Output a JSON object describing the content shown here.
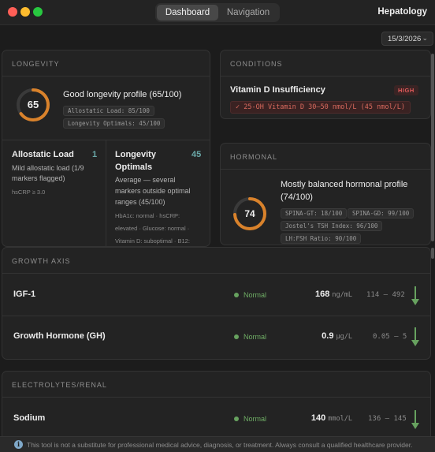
{
  "window": {
    "tabs": [
      {
        "label": "Dashboard",
        "active": true
      },
      {
        "label": "Navigation",
        "active": false
      }
    ],
    "app_title": "Hepatology",
    "traffic_lights": {
      "close": "#ff5f57",
      "minimize": "#febc2e",
      "zoom": "#28c840"
    }
  },
  "date_picker": {
    "value": "15/3/2026",
    "icon": "chevron-down-icon"
  },
  "longevity": {
    "title": "LONGEVITY",
    "score": "65",
    "score_fraction": 0.65,
    "ring_color": "#d9822b",
    "profile": "Good longevity profile (65/100)",
    "pills": [
      "Allostatic Load: 85/100",
      "Longevity Optimals: 45/100"
    ],
    "allostatic": {
      "title": "Allostatic Load",
      "count": "1",
      "desc_line1": "Mild allostatic load (1/9",
      "desc_line2": "markers flagged)",
      "detail": "hsCRP ≥ 3.0"
    },
    "optimals": {
      "title_line1": "Longevity",
      "title_line2": "Optimals",
      "count": "45",
      "desc_line1": "Average — several",
      "desc_line2": "markers outside optimal",
      "desc_line3": "ranges (45/100)",
      "detail_line1": "HbA1c: normal · hsCRP:",
      "detail_line2": "elevated · Glucose: normal ·",
      "detail_line3": "Vitamin D: suboptimal · B12:"
    }
  },
  "conditions": {
    "title": "CONDITIONS",
    "item": {
      "name": "Vitamin D Insufficiency",
      "severity": "HIGH",
      "check": "✓",
      "detail": "25-OH Vitamin D 30–50 nmol/L (45 nmol/L)"
    }
  },
  "hormonal": {
    "title": "HORMONAL",
    "score": "74",
    "score_fraction": 0.74,
    "ring_color": "#d9822b",
    "profile_line1": "Mostly balanced hormonal profile",
    "profile_line2": "(74/100)",
    "pills": [
      "SPINA-GT: 18/100",
      "SPINA-GD: 99/100",
      "Jostel's TSH Index: 96/100",
      "LH:FSH Ratio: 90/100"
    ]
  },
  "growth_axis": {
    "title": "GROWTH AXIS",
    "rows": [
      {
        "name": "IGF-1",
        "status": "Normal",
        "value": "168",
        "unit": "ng/mL",
        "range": "114 – 492"
      },
      {
        "name": "Growth Hormone (GH)",
        "status": "Normal",
        "value": "0.9",
        "unit": "µg/L",
        "range": "0.05 – 5"
      }
    ]
  },
  "electrolytes": {
    "title": "ELECTROLYTES/RENAL",
    "rows": [
      {
        "name": "Sodium",
        "status": "Normal",
        "value": "140",
        "unit": "mmol/L",
        "range": "136 – 145"
      }
    ]
  },
  "footer": {
    "icon": "info-icon",
    "text": "This tool is not a substitute for professional medical advice, diagnosis, or treatment. Always consult a qualified healthcare provider."
  }
}
